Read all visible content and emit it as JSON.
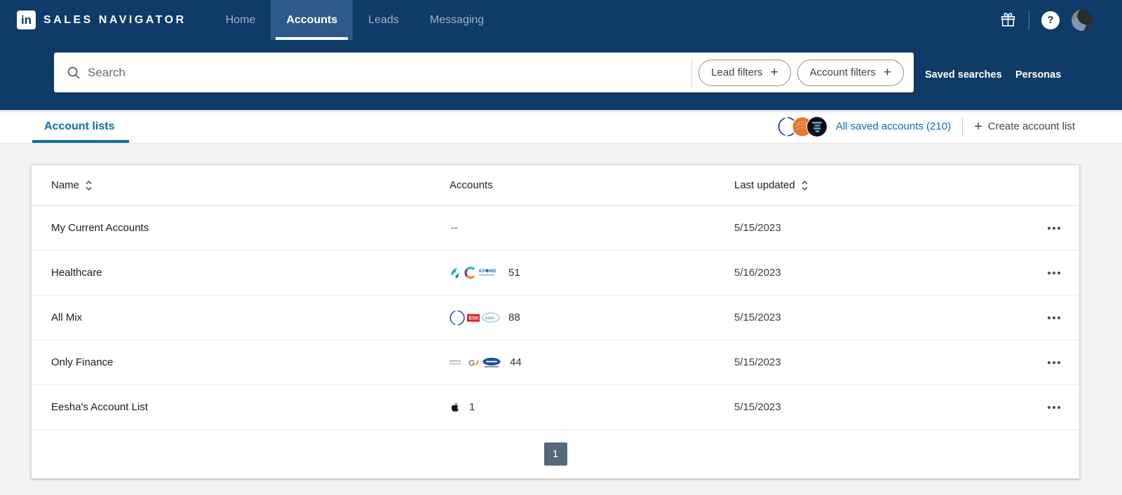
{
  "nav": {
    "logo_text": "in",
    "brand": "SALES NAVIGATOR",
    "items": [
      {
        "label": "Home",
        "active": false
      },
      {
        "label": "Accounts",
        "active": true
      },
      {
        "label": "Leads",
        "active": false
      },
      {
        "label": "Messaging",
        "active": false
      }
    ]
  },
  "header_actions": {
    "gift_icon": "gift-icon",
    "help_glyph": "?",
    "avatar": "user-avatar"
  },
  "search": {
    "placeholder": "Search",
    "lead_filters_label": "Lead filters",
    "account_filters_label": "Account filters",
    "plus_glyph": "+",
    "saved_searches_label": "Saved searches",
    "personas_label": "Personas"
  },
  "tabs": {
    "account_lists_label": "Account lists",
    "all_saved_accounts_label": "All saved accounts (210)",
    "create_account_list_plus": "+",
    "create_account_list_label": "Create account list"
  },
  "saved_accounts_logos": [
    "blue-pattern-logo",
    "orange-circle-logo",
    "black-square-logo"
  ],
  "table": {
    "headers": {
      "name": "Name",
      "accounts": "Accounts",
      "last_updated": "Last updated"
    },
    "rows": [
      {
        "name": "My Current Accounts",
        "accounts_count": "--",
        "logos": [],
        "last_updated": "5/15/2023"
      },
      {
        "name": "Healthcare",
        "accounts_count": "51",
        "logos": [
          "teal-abstract-logo",
          "multicolor-c-logo",
          "kp-md-text-logo"
        ],
        "last_updated": "5/16/2023"
      },
      {
        "name": "All Mix",
        "accounts_count": "88",
        "logos": [
          "blue-pattern-logo",
          "esk-red-logo",
          "eads-oval-logo"
        ],
        "last_updated": "5/15/2023"
      },
      {
        "name": "Only Finance",
        "accounts_count": "44",
        "logos": [
          "gray-text-logo",
          "g-orange-logo",
          "blue-oval-logo"
        ],
        "last_updated": "5/15/2023"
      },
      {
        "name": "Eesha's Account List",
        "accounts_count": "1",
        "logos": [
          "apple-logo"
        ],
        "last_updated": "5/15/2023"
      }
    ]
  },
  "pagination": {
    "current_page": "1"
  },
  "colors": {
    "navy": "#0e3b67",
    "active_tab_bg": "#2d5a88",
    "link_blue": "#0e6ba3",
    "page_bg": "#f4f3f1",
    "pagination_bg": "#566879"
  }
}
